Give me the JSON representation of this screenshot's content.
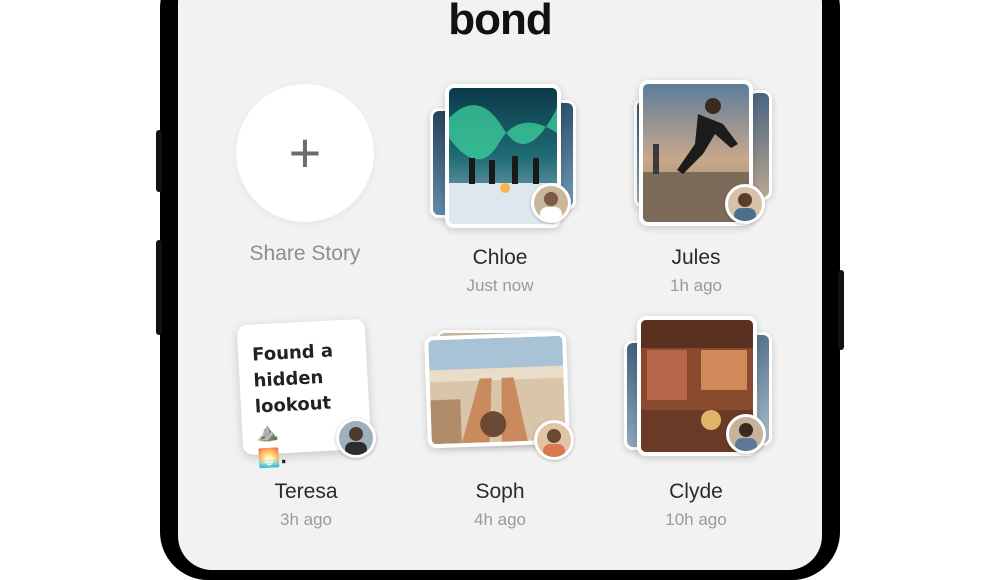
{
  "app": {
    "logo": "bond"
  },
  "share": {
    "label": "Share Story",
    "icon": "plus-icon"
  },
  "stories": [
    {
      "name": "Chloe",
      "time": "Just now"
    },
    {
      "name": "Jules",
      "time": "1h ago"
    },
    {
      "name": "Teresa",
      "time": "3h ago",
      "text_lines": [
        "Found a",
        "hidden",
        "lookout ⛰️",
        "🌅."
      ]
    },
    {
      "name": "Soph",
      "time": "4h ago"
    },
    {
      "name": "Clyde",
      "time": "10h ago"
    }
  ]
}
